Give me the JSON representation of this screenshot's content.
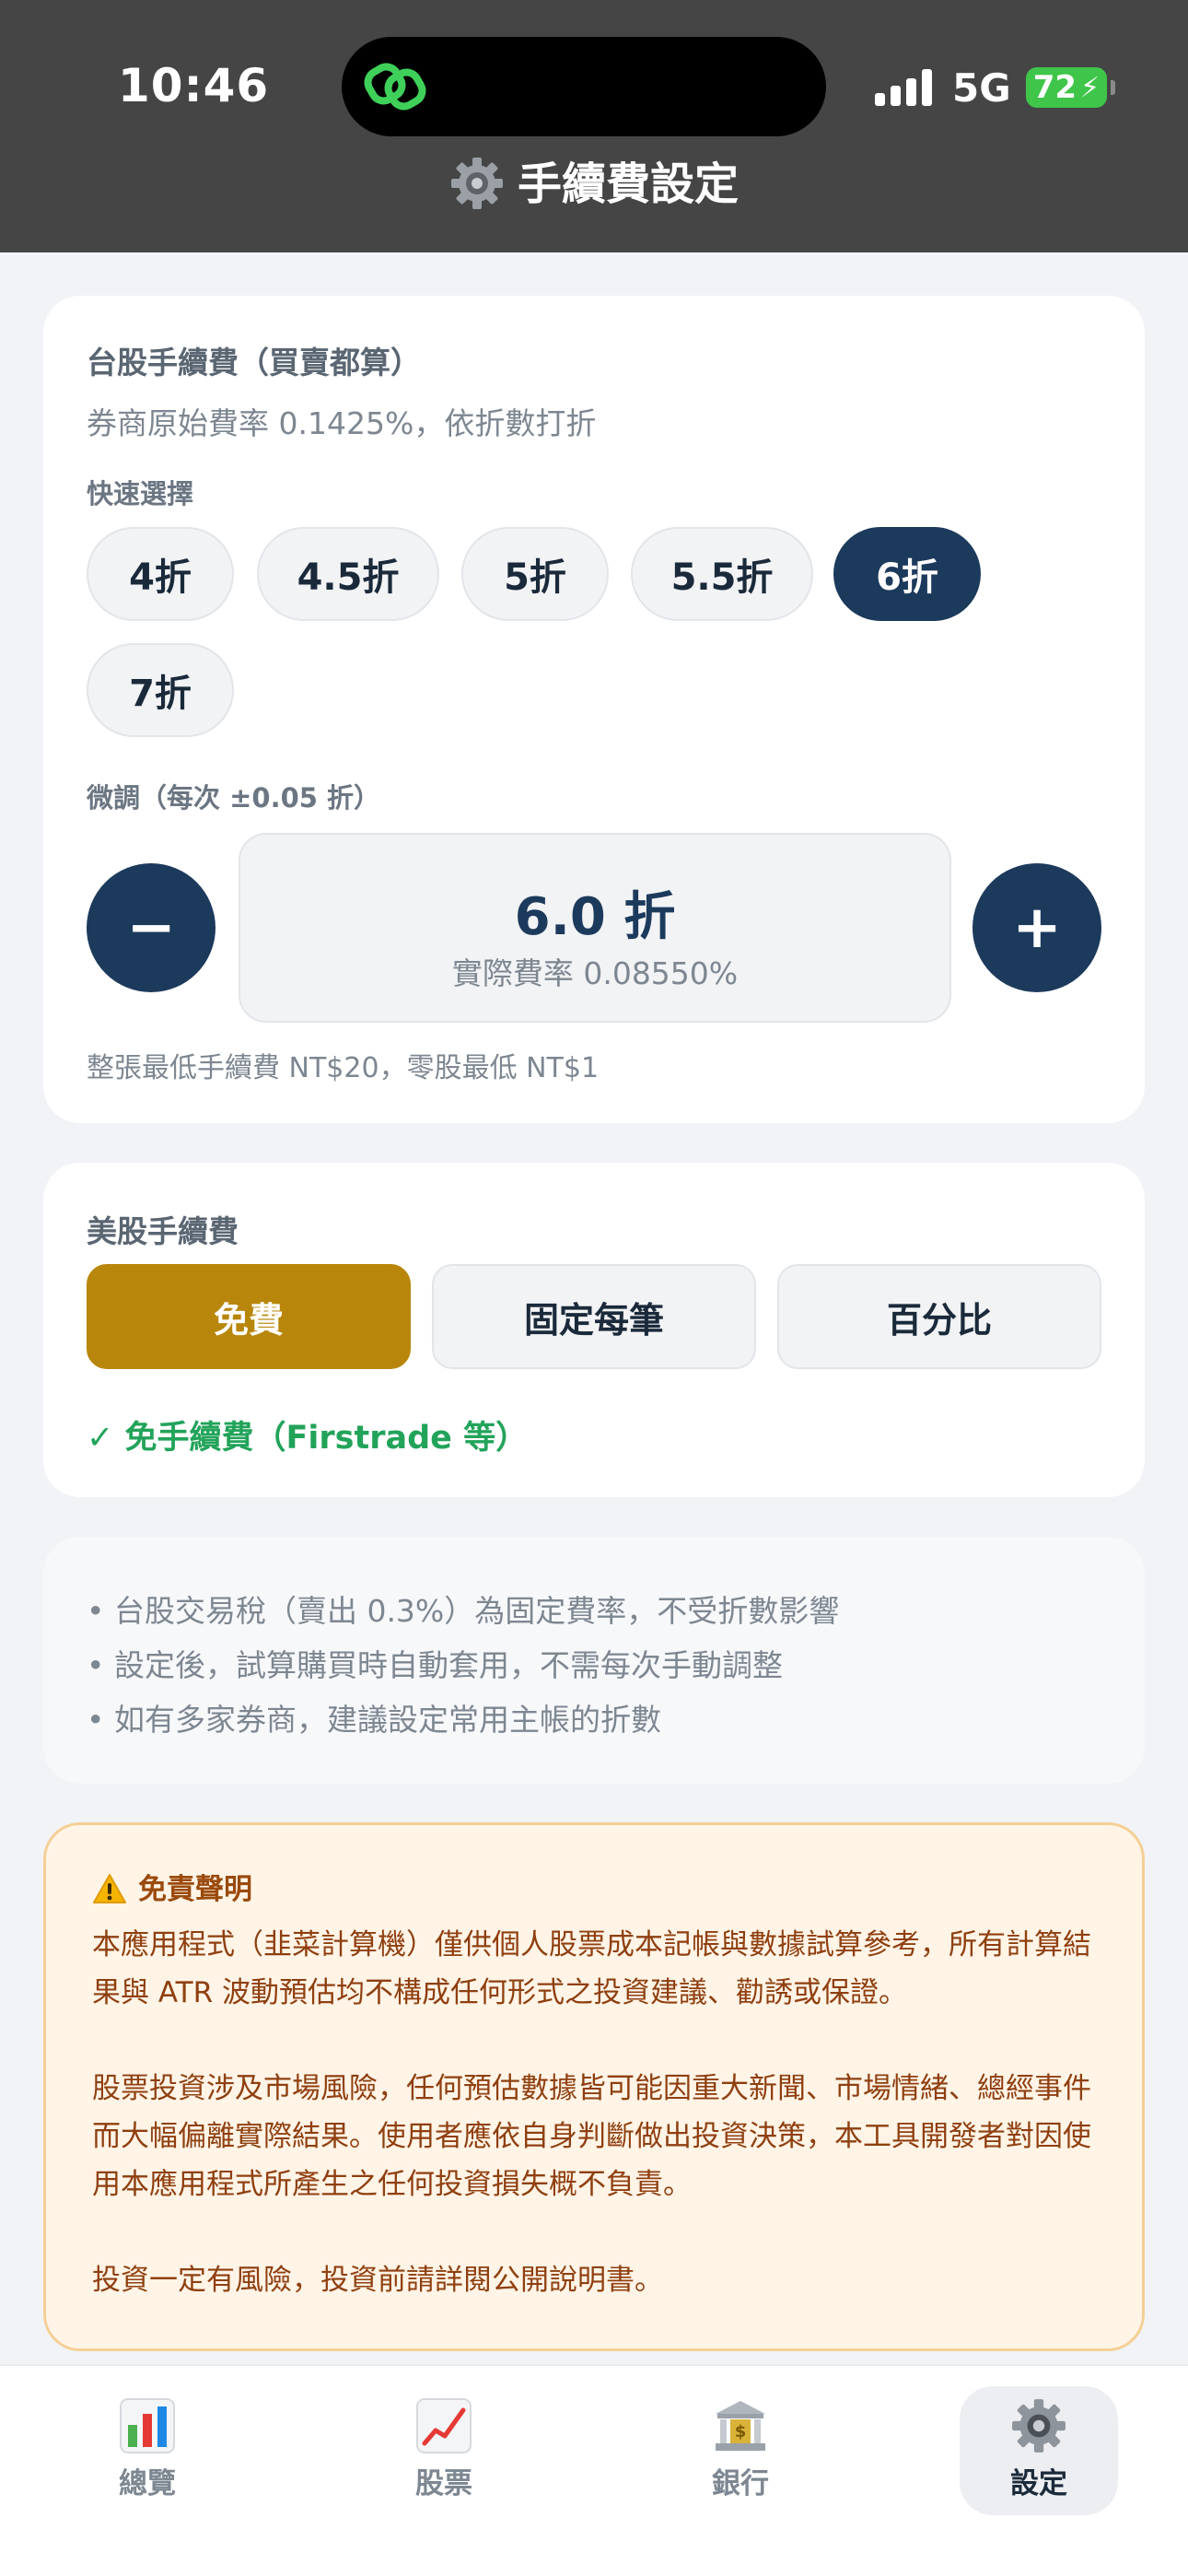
{
  "status_bar": {
    "time": "10:46",
    "network": "5G",
    "battery": "72"
  },
  "header": {
    "title": "手續費設定"
  },
  "tw_fee": {
    "title": "台股手續費（買賣都算）",
    "subtitle": "券商原始費率 0.1425%，依折數打折",
    "quick_label": "快速選擇",
    "quick_options": [
      "4折",
      "4.5折",
      "5折",
      "5.5折",
      "6折",
      "7折"
    ],
    "selected_option": "6折",
    "fine_label": "微調（每次 ±0.05 折）",
    "minus_label": "−",
    "plus_label": "+",
    "value": "6.0 折",
    "actual_rate": "實際費率 0.08550%",
    "min_fee_note": "整張最低手續費 NT$20，零股最低 NT$1"
  },
  "us_fee": {
    "title": "美股手續費",
    "options": [
      "免費",
      "固定每筆",
      "百分比"
    ],
    "selected_option": "免費",
    "free_note": "✓ 免手續費（Firstrade 等）"
  },
  "notes": [
    "• 台股交易稅（賣出 0.3%）為固定費率，不受折數影響",
    "• 設定後，試算購買時自動套用，不需每次手動調整",
    "• 如有多家券商，建議設定常用主帳的折數"
  ],
  "disclaimer": {
    "title": "免責聲明",
    "paragraphs": [
      "本應用程式（韭菜計算機）僅供個人股票成本記帳與數據試算參考，所有計算結果與 ATR 波動預估均不構成任何形式之投資建議、勸誘或保證。",
      "股票投資涉及市場風險，任何預估數據皆可能因重大新聞、市場情緒、總經事件而大幅偏離實際結果。使用者應依自身判斷做出投資決策，本工具開發者對因使用本應用程式所產生之任何投資損失概不負責。",
      "投資一定有風險，投資前請詳閱公開說明書。"
    ]
  },
  "tabs": [
    {
      "label": "總覽",
      "icon": "bar-chart-icon"
    },
    {
      "label": "股票",
      "icon": "trend-chart-icon"
    },
    {
      "label": "銀行",
      "icon": "bank-icon"
    },
    {
      "label": "設定",
      "icon": "gear-icon"
    }
  ],
  "active_tab": "設定",
  "colors": {
    "primary": "#1c3a5c",
    "gold": "#b8860b",
    "success": "#22a35a",
    "warning_bg": "#fff4e6",
    "header_bg": "#454545"
  }
}
